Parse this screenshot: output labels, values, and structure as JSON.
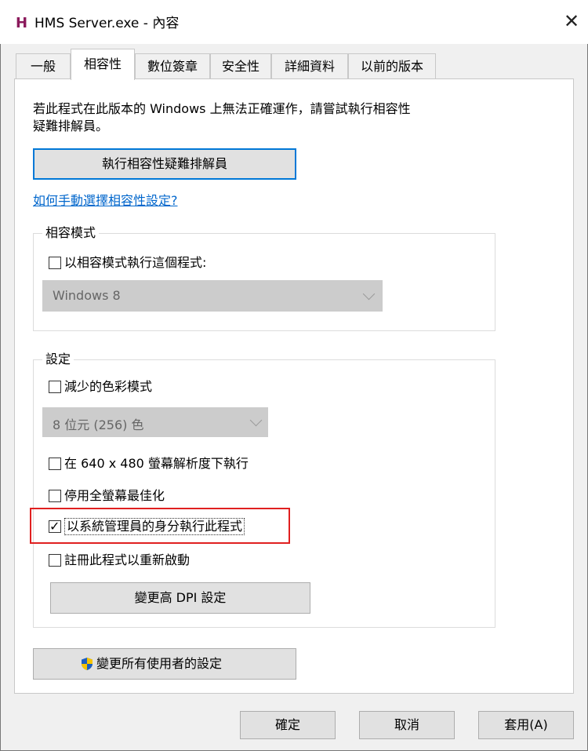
{
  "window": {
    "title": "HMS Server.exe - 內容",
    "logo_text": "H",
    "close_symbol": "✕"
  },
  "tabs": [
    {
      "label": "一般"
    },
    {
      "label": "相容性"
    },
    {
      "label": "數位簽章"
    },
    {
      "label": "安全性"
    },
    {
      "label": "詳細資料"
    },
    {
      "label": "以前的版本"
    }
  ],
  "intro_text_line1": "若此程式在此版本的 Windows 上無法正確運作，請嘗試執行相容性",
  "intro_text_line2": "疑難排解員。",
  "run_troubleshooter_button": "執行相容性疑難排解員",
  "manual_link": "如何手動選擇相容性設定?",
  "compat_mode": {
    "group_label": "相容模式",
    "checkbox_label": "以相容模式執行這個程式:",
    "checked": false,
    "select_value": "Windows 8"
  },
  "settings": {
    "group_label": "設定",
    "reduced_color": {
      "label": "減少的色彩模式",
      "checked": false
    },
    "color_select_value": "8 位元 (256) 色",
    "res_640": {
      "label": "在 640 x 480 螢幕解析度下執行",
      "checked": false
    },
    "disable_fullscreen": {
      "label": "停用全螢幕最佳化",
      "checked": false
    },
    "run_as_admin": {
      "label": "以系統管理員的身分執行此程式",
      "checked": true
    },
    "register_restart": {
      "label": "註冊此程式以重新啟動",
      "checked": false
    },
    "dpi_button": "變更高 DPI 設定"
  },
  "change_all_users_button": "變更所有使用者的設定",
  "footer": {
    "ok": "確定",
    "cancel": "取消",
    "apply": "套用(A)"
  },
  "colors": {
    "accent": "#0078d7",
    "link": "#0066cc",
    "highlight_box": "#e02020",
    "logo": "#8b1a5c"
  }
}
